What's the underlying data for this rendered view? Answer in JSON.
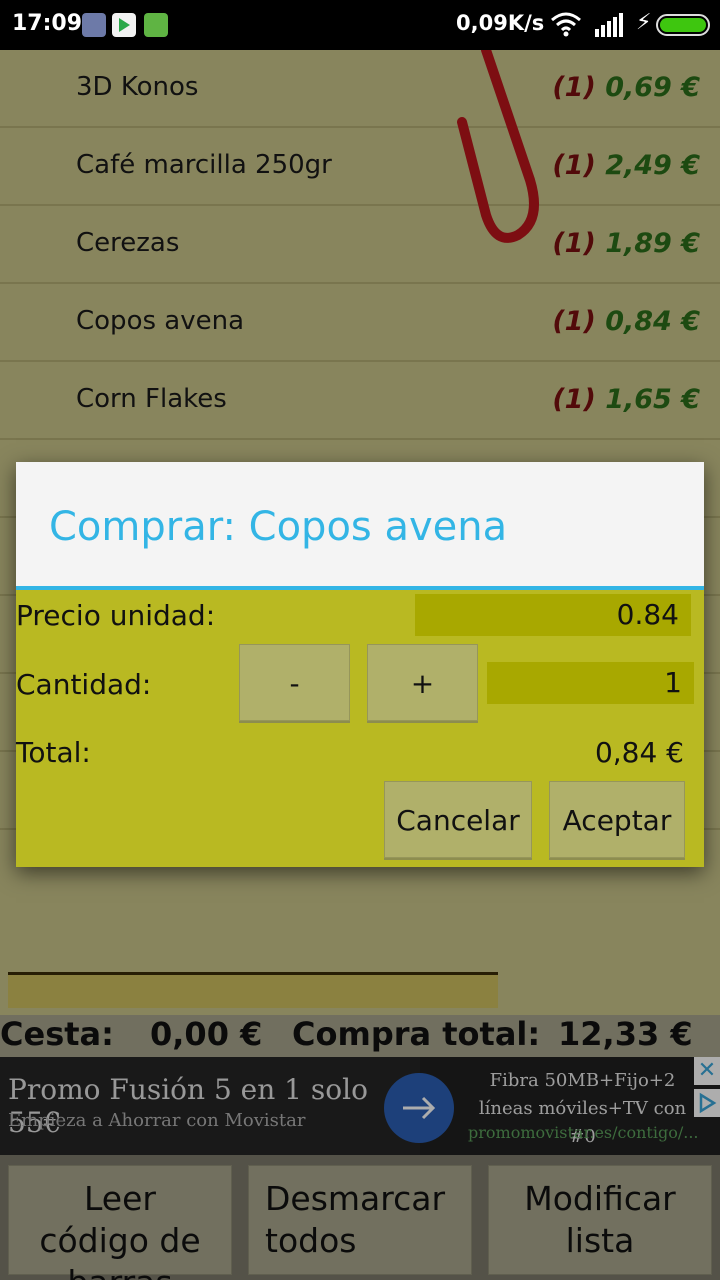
{
  "status_bar": {
    "time": "17:09",
    "net_speed": "0,09K/s",
    "icons": [
      "kodi-icon",
      "play-store-icon",
      "android-icon",
      "wifi-icon",
      "signal-icon",
      "charging-icon",
      "battery-icon"
    ]
  },
  "list": {
    "items": [
      {
        "name": "3D Konos",
        "qty": "(1)",
        "price": "0,69 €"
      },
      {
        "name": "Café marcilla 250gr",
        "qty": "(1)",
        "price": "2,49 €"
      },
      {
        "name": "Cerezas",
        "qty": "(1)",
        "price": "1,89 €"
      },
      {
        "name": "Copos avena",
        "qty": "(1)",
        "price": "0,84 €"
      },
      {
        "name": "Corn Flakes",
        "qty": "(1)",
        "price": "1,65 €"
      }
    ]
  },
  "dialog": {
    "title": "Comprar: Copos avena",
    "unit_price_label": "Precio unidad:",
    "unit_price_value": "0.84",
    "quantity_label": "Cantidad:",
    "minus_label": "-",
    "plus_label": "+",
    "quantity_value": "1",
    "total_label": "Total:",
    "total_value": "0,84 €",
    "cancel_label": "Cancelar",
    "accept_label": "Aceptar",
    "accent_color": "#33b5e5"
  },
  "totals": {
    "basket_label": "Cesta:",
    "basket_value": "0,00 €",
    "total_label": "Compra total:",
    "total_value": "12,33 €"
  },
  "ad": {
    "headline": "Promo Fusión 5 en 1 solo 55€",
    "subline": "Empieza a Ahorrar con Movistar",
    "right_text": "Fibra 50MB+Fijo+2 líneas móviles+TV con #0",
    "url": "promomovistar.es/contigo/..."
  },
  "bottom_buttons": {
    "scan": "Leer código de barras",
    "unmark": "Desmarcar todos",
    "modify": "Modificar lista"
  }
}
